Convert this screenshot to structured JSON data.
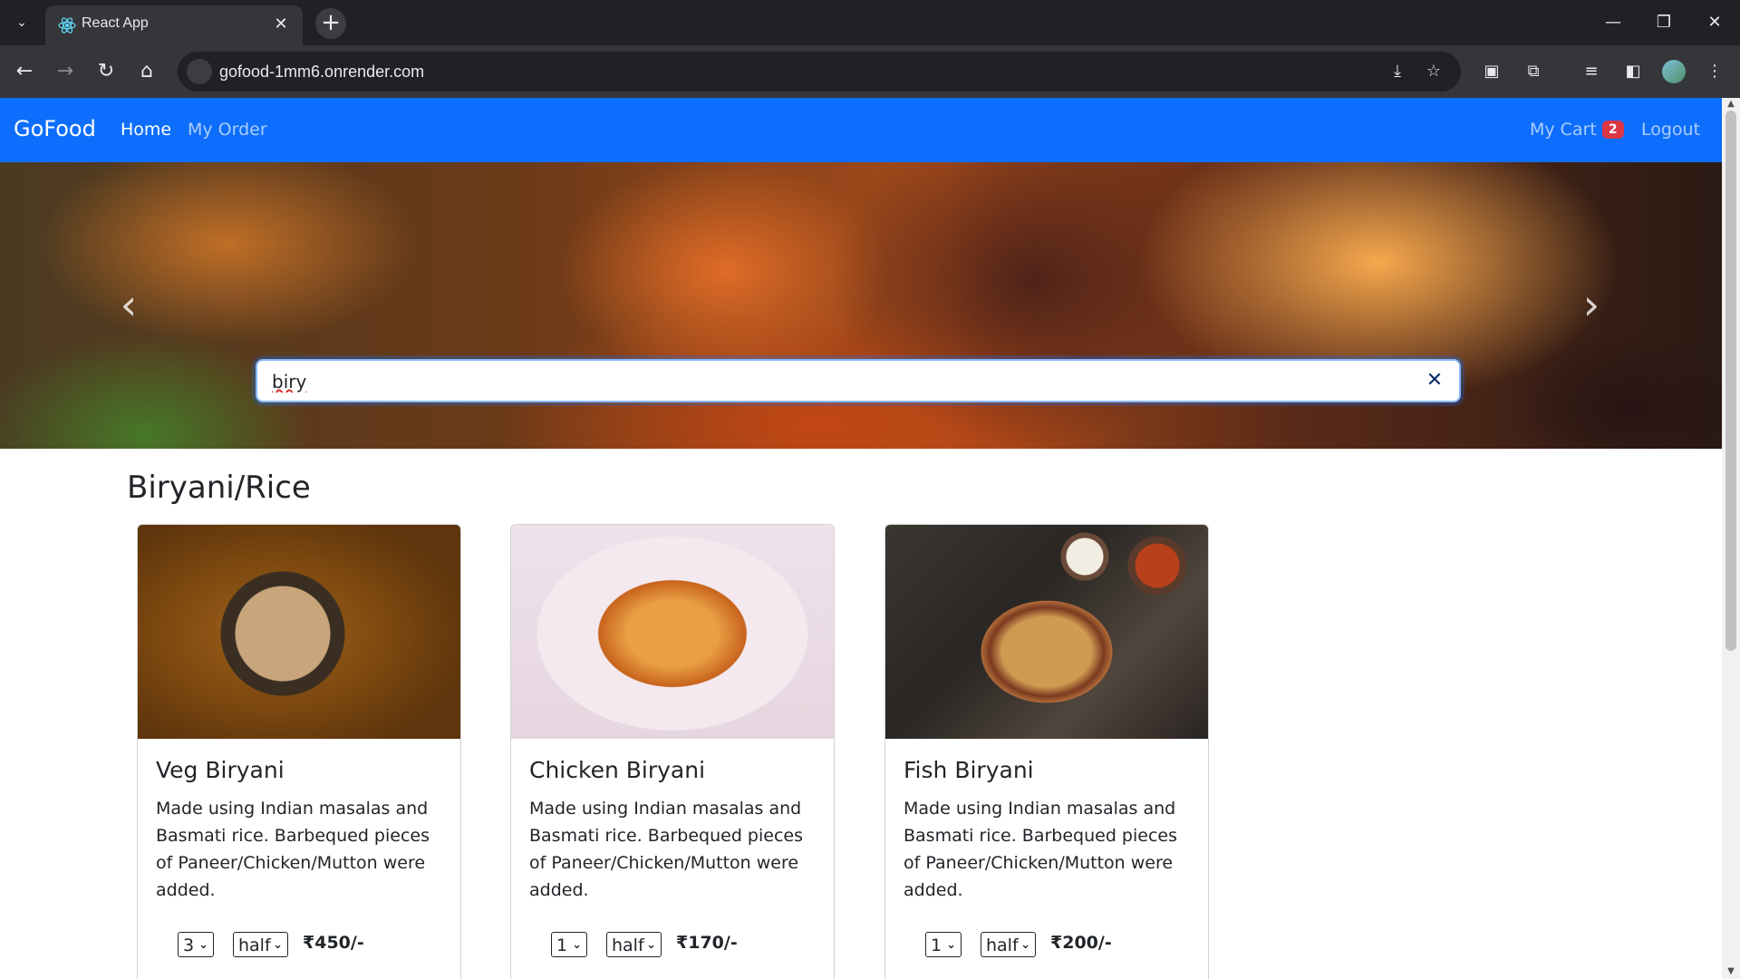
{
  "browser": {
    "tab_title": "React App",
    "tab_close": "✕",
    "new_tab": "+",
    "url": "gofood-1mm6.onrender.com",
    "icons": [
      "tab-list-icon",
      "react-favicon-icon",
      "back-icon",
      "forward-icon",
      "reload-icon",
      "home-icon",
      "site-info-icon",
      "install-icon",
      "bookmark-star-icon",
      "cast-icon",
      "extensions-icon",
      "reading-list-icon",
      "side-panel-icon",
      "profile-avatar-icon",
      "menu-icon"
    ]
  },
  "navbar": {
    "brand": "GoFood",
    "links": [
      {
        "label": "Home",
        "active": true
      },
      {
        "label": "My Order",
        "active": false
      }
    ],
    "cart_label": "My Cart",
    "cart_count": "2",
    "logout_label": "Logout",
    "bg_color": "#0d6efd"
  },
  "hero": {
    "search_value": "biry",
    "prev_arrow": "‹",
    "next_arrow": "›",
    "clear_label": "✕"
  },
  "section": {
    "title": "Biryani/Rice",
    "items": [
      {
        "name": "Veg Biryani",
        "description": "Made using Indian masalas and Basmati rice. Barbequed pieces of Paneer/Chicken/Mutton were added.",
        "quantity": "3",
        "size": "half",
        "price": "₹450/-"
      },
      {
        "name": "Chicken Biryani",
        "description": "Made using Indian masalas and Basmati rice. Barbequed pieces of Paneer/Chicken/Mutton were added.",
        "quantity": "1",
        "size": "half",
        "price": "₹170/-"
      },
      {
        "name": "Fish Biryani",
        "description": "Made using Indian masalas and Basmati rice. Barbequed pieces of Paneer/Chicken/Mutton were added.",
        "quantity": "1",
        "size": "half",
        "price": "₹200/-"
      }
    ]
  }
}
